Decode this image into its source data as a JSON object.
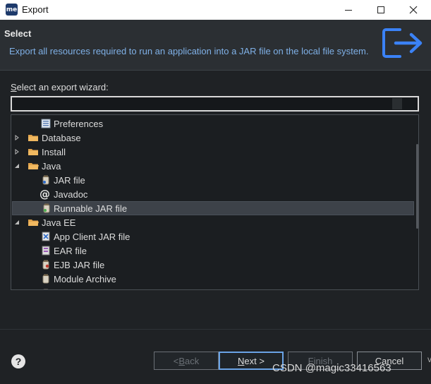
{
  "window": {
    "app_badge": "me",
    "title": "Export"
  },
  "header": {
    "title": "Select",
    "description": "Export all resources required to run an application into a JAR file on the local file system.",
    "icon": "export-icon",
    "accent": "#3b82f6"
  },
  "wizard": {
    "label_first": "S",
    "label_rest": "elect an export wizard:",
    "filter_value": ""
  },
  "tree": {
    "items": [
      {
        "label": "Preferences",
        "icon": "preferences-icon",
        "level": 2,
        "expander": "none"
      },
      {
        "label": "Database",
        "icon": "folder-icon",
        "level": 1,
        "expander": "collapsed"
      },
      {
        "label": "Install",
        "icon": "folder-icon",
        "level": 1,
        "expander": "collapsed"
      },
      {
        "label": "Java",
        "icon": "folder-icon",
        "level": 1,
        "expander": "expanded"
      },
      {
        "label": "JAR file",
        "icon": "jar-icon",
        "level": 2,
        "expander": "none"
      },
      {
        "label": "Javadoc",
        "icon": "javadoc-icon",
        "level": 2,
        "expander": "none"
      },
      {
        "label": "Runnable JAR file",
        "icon": "runnable-jar-icon",
        "level": 2,
        "expander": "none",
        "selected": true
      },
      {
        "label": "Java EE",
        "icon": "folder-icon",
        "level": 1,
        "expander": "expanded"
      },
      {
        "label": "App Client JAR file",
        "icon": "app-client-jar-icon",
        "level": 2,
        "expander": "none"
      },
      {
        "label": "EAR file",
        "icon": "ear-icon",
        "level": 2,
        "expander": "none"
      },
      {
        "label": "EJB JAR file",
        "icon": "ejb-jar-icon",
        "level": 2,
        "expander": "none"
      },
      {
        "label": "Module Archive",
        "icon": "module-archive-icon",
        "level": 2,
        "expander": "none"
      }
    ]
  },
  "buttons": {
    "back_pre": "< ",
    "back_u": "B",
    "back_rest": "ack",
    "next_u": "N",
    "next_rest": "ext >",
    "finish_u": "F",
    "finish_rest": "inish",
    "cancel": "Cancel"
  },
  "help_glyph": "?",
  "watermark": "CSDN @magic33416563",
  "edge_glyph": "v"
}
